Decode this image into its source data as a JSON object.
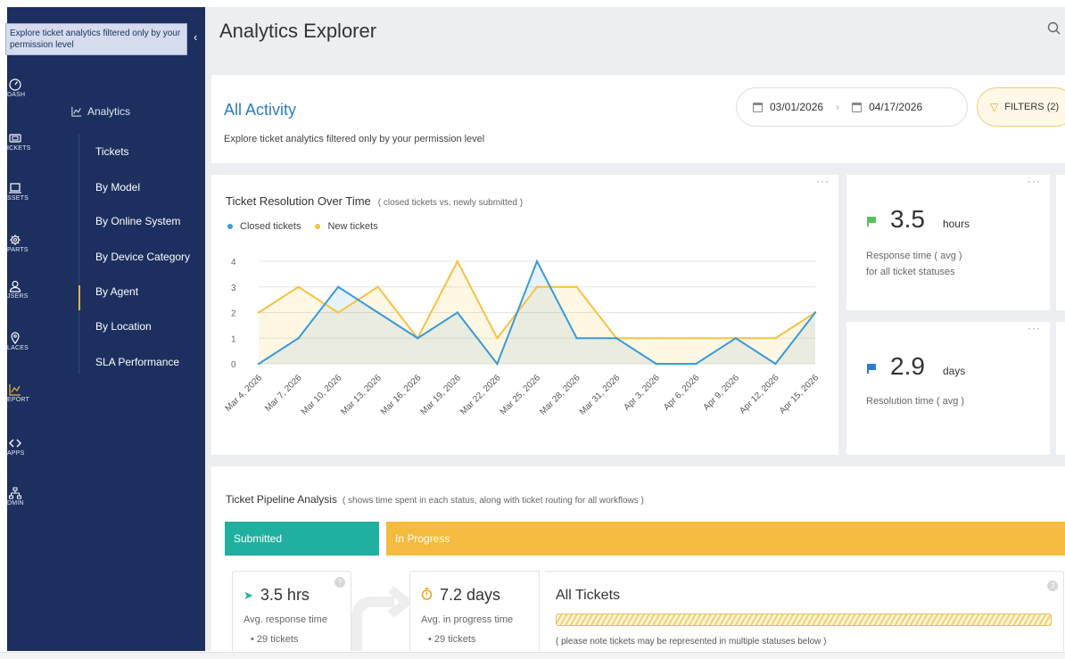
{
  "rail": [
    {
      "id": "dash",
      "label": "DASH",
      "icon": "gauge-icon"
    },
    {
      "id": "tickets",
      "label": "ICKETS",
      "icon": "ticket-icon"
    },
    {
      "id": "assets",
      "label": "SSETS",
      "icon": "laptop-icon"
    },
    {
      "id": "parts",
      "label": "PARTS",
      "icon": "gear-icon"
    },
    {
      "id": "users",
      "label": "JSERS",
      "icon": "user-icon"
    },
    {
      "id": "places",
      "label": "LACES",
      "icon": "pin-icon"
    },
    {
      "id": "report",
      "label": "EPORT",
      "icon": "chart-icon"
    },
    {
      "id": "apps",
      "label": "APPS",
      "icon": "code-icon"
    },
    {
      "id": "admin",
      "label": "DMIN",
      "icon": "org-icon"
    }
  ],
  "tooltip": "Explore ticket analytics filtered only by your permission level",
  "subnav": {
    "section": "Analytics",
    "items": [
      "Tickets",
      "By Model",
      "By Online System",
      "By Device Category",
      "By Agent",
      "By Location",
      "SLA Performance"
    ]
  },
  "header": {
    "title": "Analytics Explorer"
  },
  "activity": {
    "title": "All Activity",
    "subtitle": "Explore ticket analytics filtered only by your permission level",
    "date_from": "03/01/2026",
    "date_to": "04/17/2026",
    "filters_label": "FILTERS (2)"
  },
  "chart_card": {
    "title": "Ticket Resolution Over Time",
    "note": "( closed tickets vs. newly submitted )",
    "menu": "···"
  },
  "chart_data": {
    "type": "area",
    "x": [
      "Mar 4, 2026",
      "Mar 7, 2026",
      "Mar 10, 2026",
      "Mar 13, 2026",
      "Mar 16, 2026",
      "Mar 19, 2026",
      "Mar 22, 2026",
      "Mar 25, 2026",
      "Mar 28, 2026",
      "Mar 31, 2026",
      "Apr 3, 2026",
      "Apr 6, 2026",
      "Apr 9, 2026",
      "Apr 12, 2026",
      "Apr 15, 2026"
    ],
    "series": [
      {
        "name": "Closed tickets",
        "color": "#3a9ad9",
        "values": [
          0,
          1,
          3,
          2,
          1,
          2,
          0,
          4,
          1,
          1,
          0,
          0,
          1,
          0,
          2
        ]
      },
      {
        "name": "New tickets",
        "color": "#f5c342",
        "values": [
          2,
          3,
          2,
          3,
          1,
          4,
          1,
          3,
          3,
          1,
          1,
          1,
          1,
          1,
          2
        ]
      }
    ],
    "ylim": [
      0,
      4
    ],
    "yticks": [
      "0",
      "1",
      "2",
      "3",
      "4"
    ],
    "grid": true,
    "legend": "top-left"
  },
  "metrics": [
    {
      "value": "3.5",
      "unit": "hours",
      "line1": "Response time ( avg )",
      "line2": "for all ticket statuses",
      "color": "#5cc25a"
    },
    {
      "value": "2.9",
      "unit": "days",
      "line1": "Resolution time ( avg )",
      "line2": "",
      "color": "#2a7cd6"
    }
  ],
  "pipeline": {
    "title": "Ticket Pipeline Analysis",
    "note": "( shows time spent in each status, along with ticket routing for all workflows )",
    "stages": [
      "Submitted",
      "In Progress"
    ],
    "submitted": {
      "value": "3.5 hrs",
      "label": "Avg. response time",
      "count": "29 tickets"
    },
    "progress": {
      "value": "7.2 days",
      "label": "Avg. in progress time",
      "count": "29 tickets"
    },
    "all_tickets": {
      "title": "All Tickets",
      "note": "( please note tickets may be represented in multiple statuses below )"
    }
  }
}
